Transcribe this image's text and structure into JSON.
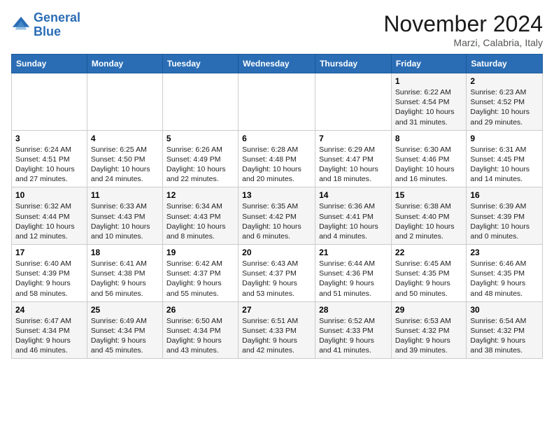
{
  "header": {
    "logo_line1": "General",
    "logo_line2": "Blue",
    "month": "November 2024",
    "location": "Marzi, Calabria, Italy"
  },
  "weekdays": [
    "Sunday",
    "Monday",
    "Tuesday",
    "Wednesday",
    "Thursday",
    "Friday",
    "Saturday"
  ],
  "weeks": [
    [
      {
        "day": "",
        "info": ""
      },
      {
        "day": "",
        "info": ""
      },
      {
        "day": "",
        "info": ""
      },
      {
        "day": "",
        "info": ""
      },
      {
        "day": "",
        "info": ""
      },
      {
        "day": "1",
        "info": "Sunrise: 6:22 AM\nSunset: 4:54 PM\nDaylight: 10 hours\nand 31 minutes."
      },
      {
        "day": "2",
        "info": "Sunrise: 6:23 AM\nSunset: 4:52 PM\nDaylight: 10 hours\nand 29 minutes."
      }
    ],
    [
      {
        "day": "3",
        "info": "Sunrise: 6:24 AM\nSunset: 4:51 PM\nDaylight: 10 hours\nand 27 minutes."
      },
      {
        "day": "4",
        "info": "Sunrise: 6:25 AM\nSunset: 4:50 PM\nDaylight: 10 hours\nand 24 minutes."
      },
      {
        "day": "5",
        "info": "Sunrise: 6:26 AM\nSunset: 4:49 PM\nDaylight: 10 hours\nand 22 minutes."
      },
      {
        "day": "6",
        "info": "Sunrise: 6:28 AM\nSunset: 4:48 PM\nDaylight: 10 hours\nand 20 minutes."
      },
      {
        "day": "7",
        "info": "Sunrise: 6:29 AM\nSunset: 4:47 PM\nDaylight: 10 hours\nand 18 minutes."
      },
      {
        "day": "8",
        "info": "Sunrise: 6:30 AM\nSunset: 4:46 PM\nDaylight: 10 hours\nand 16 minutes."
      },
      {
        "day": "9",
        "info": "Sunrise: 6:31 AM\nSunset: 4:45 PM\nDaylight: 10 hours\nand 14 minutes."
      }
    ],
    [
      {
        "day": "10",
        "info": "Sunrise: 6:32 AM\nSunset: 4:44 PM\nDaylight: 10 hours\nand 12 minutes."
      },
      {
        "day": "11",
        "info": "Sunrise: 6:33 AM\nSunset: 4:43 PM\nDaylight: 10 hours\nand 10 minutes."
      },
      {
        "day": "12",
        "info": "Sunrise: 6:34 AM\nSunset: 4:43 PM\nDaylight: 10 hours\nand 8 minutes."
      },
      {
        "day": "13",
        "info": "Sunrise: 6:35 AM\nSunset: 4:42 PM\nDaylight: 10 hours\nand 6 minutes."
      },
      {
        "day": "14",
        "info": "Sunrise: 6:36 AM\nSunset: 4:41 PM\nDaylight: 10 hours\nand 4 minutes."
      },
      {
        "day": "15",
        "info": "Sunrise: 6:38 AM\nSunset: 4:40 PM\nDaylight: 10 hours\nand 2 minutes."
      },
      {
        "day": "16",
        "info": "Sunrise: 6:39 AM\nSunset: 4:39 PM\nDaylight: 10 hours\nand 0 minutes."
      }
    ],
    [
      {
        "day": "17",
        "info": "Sunrise: 6:40 AM\nSunset: 4:39 PM\nDaylight: 9 hours\nand 58 minutes."
      },
      {
        "day": "18",
        "info": "Sunrise: 6:41 AM\nSunset: 4:38 PM\nDaylight: 9 hours\nand 56 minutes."
      },
      {
        "day": "19",
        "info": "Sunrise: 6:42 AM\nSunset: 4:37 PM\nDaylight: 9 hours\nand 55 minutes."
      },
      {
        "day": "20",
        "info": "Sunrise: 6:43 AM\nSunset: 4:37 PM\nDaylight: 9 hours\nand 53 minutes."
      },
      {
        "day": "21",
        "info": "Sunrise: 6:44 AM\nSunset: 4:36 PM\nDaylight: 9 hours\nand 51 minutes."
      },
      {
        "day": "22",
        "info": "Sunrise: 6:45 AM\nSunset: 4:35 PM\nDaylight: 9 hours\nand 50 minutes."
      },
      {
        "day": "23",
        "info": "Sunrise: 6:46 AM\nSunset: 4:35 PM\nDaylight: 9 hours\nand 48 minutes."
      }
    ],
    [
      {
        "day": "24",
        "info": "Sunrise: 6:47 AM\nSunset: 4:34 PM\nDaylight: 9 hours\nand 46 minutes."
      },
      {
        "day": "25",
        "info": "Sunrise: 6:49 AM\nSunset: 4:34 PM\nDaylight: 9 hours\nand 45 minutes."
      },
      {
        "day": "26",
        "info": "Sunrise: 6:50 AM\nSunset: 4:34 PM\nDaylight: 9 hours\nand 43 minutes."
      },
      {
        "day": "27",
        "info": "Sunrise: 6:51 AM\nSunset: 4:33 PM\nDaylight: 9 hours\nand 42 minutes."
      },
      {
        "day": "28",
        "info": "Sunrise: 6:52 AM\nSunset: 4:33 PM\nDaylight: 9 hours\nand 41 minutes."
      },
      {
        "day": "29",
        "info": "Sunrise: 6:53 AM\nSunset: 4:32 PM\nDaylight: 9 hours\nand 39 minutes."
      },
      {
        "day": "30",
        "info": "Sunrise: 6:54 AM\nSunset: 4:32 PM\nDaylight: 9 hours\nand 38 minutes."
      }
    ]
  ]
}
